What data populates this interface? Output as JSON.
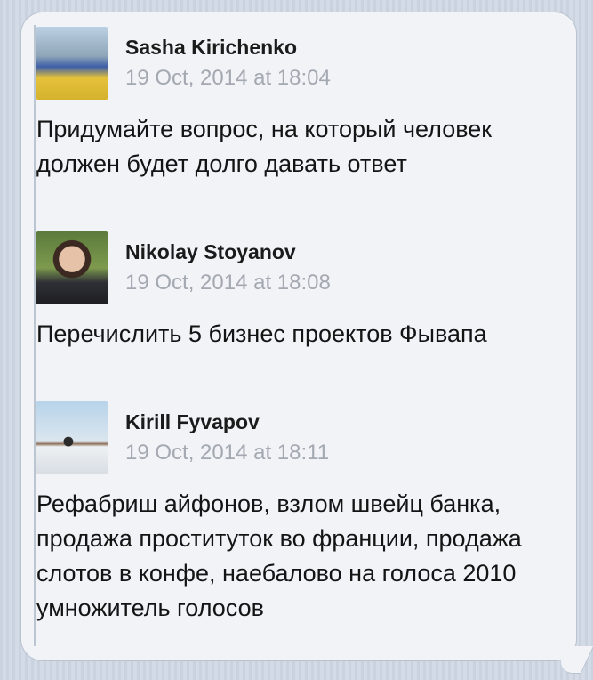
{
  "messages": [
    {
      "author": "Sasha Kirichenko",
      "time": "19 Oct, 2014 at 18:04",
      "text": "Придумайте вопрос, на который человек должен будет долго давать ответ"
    },
    {
      "author": "Nikolay Stoyanov",
      "time": "19 Oct, 2014 at 18:08",
      "text": "Перечислить 5 бизнес проектов Фывапа"
    },
    {
      "author": "Kirill Fyvapov",
      "time": "19 Oct, 2014 at 18:11",
      "text": "Рефабриш айфонов, взлом швейц банка, продажа проституток во франции, продажа слотов в конфе, наебалово на голоса 2010 умножитель голосов"
    }
  ]
}
